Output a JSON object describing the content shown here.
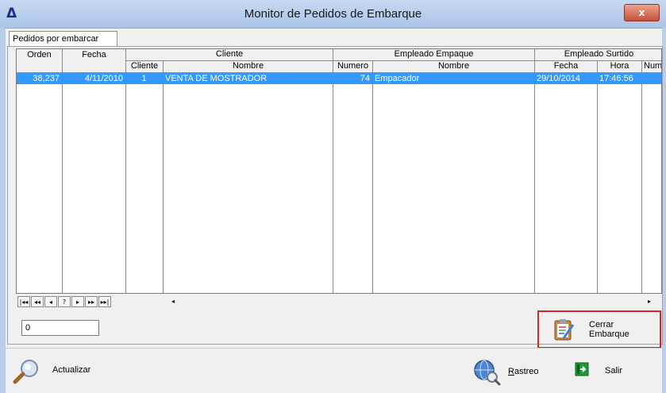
{
  "window": {
    "title": "Monitor de Pedidos de Embarque",
    "close_label": "x"
  },
  "tabs": [
    {
      "label": "Pedidos por embarcar",
      "active": true
    }
  ],
  "grid": {
    "headers": {
      "orden": "Orden",
      "fecha": "Fecha",
      "cliente_group": "Cliente",
      "cliente": "Cliente",
      "cliente_nombre": "Nombre",
      "empaque_group": "Empleado Empaque",
      "empaque_numero": "Numero",
      "empaque_nombre": "Nombre",
      "surtido_group": "Empleado Surtido",
      "surtido_fecha": "Fecha",
      "surtido_hora": "Hora",
      "surtido_num": "Num"
    },
    "rows": [
      {
        "orden": "38,237",
        "fecha": "4/11/2010",
        "cliente": "1",
        "cliente_nombre": "VENTA DE MOSTRADOR",
        "empaque_numero": "74",
        "empaque_nombre": "Empacador",
        "surtido_fecha": "29/10/2014",
        "surtido_hora": "17:46:56",
        "selected": true
      }
    ]
  },
  "navigator": {
    "first": "|◂◂",
    "prev_page": "◂◂",
    "prev": "◂",
    "search": "?",
    "next": "▸",
    "next_page": "▸▸",
    "last": "▸▸|",
    "scroll_left": "◂",
    "scroll_right": "▸"
  },
  "count_field": {
    "value": "0"
  },
  "buttons": {
    "cerrar_line1": "Cerrar",
    "cerrar_line2": "Embarque",
    "actualizar": "Actualizar",
    "rastreo_accel": "R",
    "rastreo_rest": "astreo",
    "salir": "Salir"
  },
  "icons": {
    "app": "triangle-icon",
    "cerrar": "clipboard-pencil-icon",
    "actualizar": "magnifier-icon",
    "rastreo": "globe-magnifier-icon",
    "salir": "exit-door-icon"
  },
  "colors": {
    "selection": "#3399ff",
    "highlight_frame": "#e2202a",
    "titlebar": "#aac4e8"
  }
}
